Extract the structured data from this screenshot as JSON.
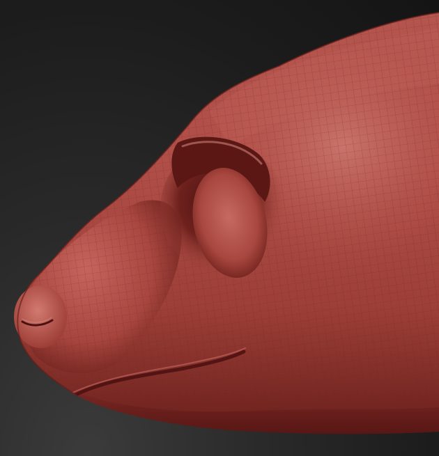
{
  "scene": {
    "subject": "sculpted-head-model",
    "colors": {
      "background_dark": "#141414",
      "background_mid": "#2f2f2f",
      "clay_base": "#9a3a34",
      "clay_light": "#c56a62",
      "clay_shadow": "#5a1815",
      "clay_deep_shadow": "#3a0d0b",
      "wire": "#7a2a25"
    }
  }
}
